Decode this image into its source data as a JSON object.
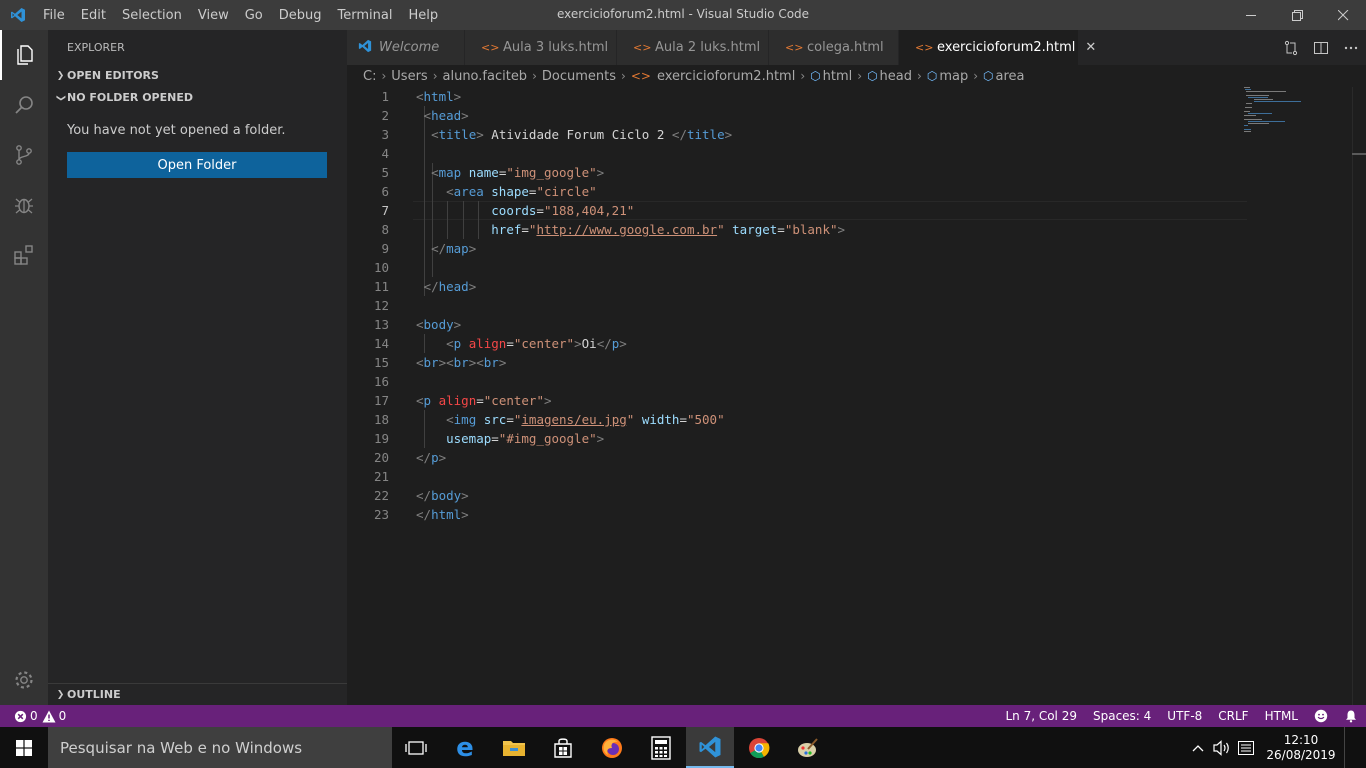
{
  "window": {
    "title": "exercicioforum2.html - Visual Studio Code",
    "menu": [
      "File",
      "Edit",
      "Selection",
      "View",
      "Go",
      "Debug",
      "Terminal",
      "Help"
    ]
  },
  "sidebar": {
    "header": "EXPLORER",
    "open_editors": "OPEN EDITORS",
    "no_folder": "NO FOLDER OPENED",
    "message": "You have not yet opened a folder.",
    "open_folder_button": "Open Folder",
    "outline": "OUTLINE"
  },
  "tabs": [
    {
      "label": "Welcome",
      "icon": "vscode-icon"
    },
    {
      "label": "Aula 3 luks.html",
      "icon": "html-icon"
    },
    {
      "label": "Aula 2 luks.html",
      "icon": "html-icon"
    },
    {
      "label": "colega.html",
      "icon": "html-icon"
    },
    {
      "label": "exercicioforum2.html",
      "icon": "html-icon",
      "active": true
    }
  ],
  "breadcrumbs": [
    "C:",
    "Users",
    "aluno.faciteb",
    "Documents",
    "exercicioforum2.html",
    "html",
    "head",
    "map",
    "area"
  ],
  "editor": {
    "current_line": 7,
    "lines": [
      "<html>",
      " <head>",
      "  <title> Atividade Forum Ciclo 2 </title>",
      "",
      "  <map name=\"img_google\">",
      "    <area shape=\"circle\"",
      "          coords=\"188,404,21\"",
      "          href=\"http://www.google.com.br\" target=\"blank\">",
      "  </map>",
      "",
      " </head>",
      "",
      "<body>",
      "    <p align=\"center\">Oi</p>",
      "<br><br><br>",
      "",
      "<p align=\"center\">",
      "    <img src=\"imagens/eu.jpg\" width=\"500\"",
      "    usemap=\"#img_google\">",
      "</p>",
      "",
      "</body>",
      "</html>"
    ]
  },
  "status": {
    "errors": "0",
    "warnings": "0",
    "position": "Ln 7, Col 29",
    "spaces": "Spaces: 4",
    "encoding": "UTF-8",
    "eol": "CRLF",
    "language": "HTML"
  },
  "taskbar": {
    "search_placeholder": "Pesquisar na Web e no Windows",
    "time": "12:10",
    "date": "26/08/2019"
  },
  "colors": {
    "status_bar": "#68217a",
    "button": "#0e639c",
    "tag": "#569cd6",
    "attribute": "#9cdcfe",
    "string": "#ce9178"
  }
}
